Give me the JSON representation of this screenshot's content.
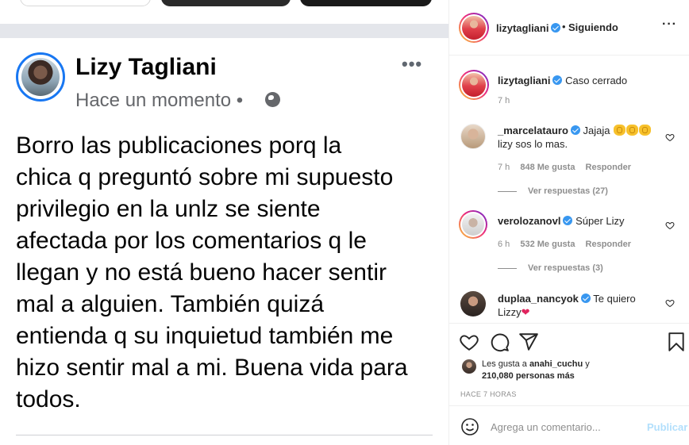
{
  "post_image": {
    "author": "Lizy Tagliani",
    "time": "Hace un momento •",
    "more": "•••",
    "text_lines": [
      "Borro las publicaciones porq la",
      "chica q preguntó sobre mi supuesto",
      "privilegio en la  unlz se siente",
      "afectada por los comentarios q le",
      "llegan y no está bueno hacer sentir",
      "mal a alguien. También quizá",
      "entienda q su inquietud también me",
      "hizo sentir mal a mi. Buena vida para",
      "todos."
    ]
  },
  "header": {
    "username": "lizytagliani",
    "separator": "•",
    "follow_status": "Siguiendo",
    "more": "···"
  },
  "caption": {
    "username": "lizytagliani",
    "text": "Caso cerrado",
    "time": "7 h"
  },
  "comments": [
    {
      "username": "_marcelatauro",
      "text": "Jajaja",
      "text2": "lizy sos lo mas.",
      "time": "7 h",
      "likes": "848 Me gusta",
      "reply": "Responder",
      "view_replies": "Ver respuestas (27)"
    },
    {
      "username": "verolozanovl",
      "text": "Súper Lizy",
      "time": "6 h",
      "likes": "532 Me gusta",
      "reply": "Responder",
      "view_replies": "Ver respuestas (3)"
    },
    {
      "username": "duplaa_nancyok",
      "text": "Te quiero",
      "text2": "Lizzy"
    }
  ],
  "likes": {
    "prefix": "Les gusta a",
    "user": "anahi_cuchu",
    "middle": "y",
    "count": "210,080 personas más"
  },
  "timestamp": "HACE 7 HORAS",
  "add_comment": {
    "placeholder": "Agrega un comentario...",
    "publish": "Publicar"
  },
  "colors": {
    "verified": "#3897f0",
    "publish_disabled": "#b2dffc",
    "fb_ring": "#1877f2"
  },
  "icons": [
    "globe-icon",
    "verified-icon",
    "heart-icon",
    "comment-icon",
    "share-icon",
    "bookmark-icon",
    "emoji-icon",
    "clap-emoji",
    "red-heart-emoji"
  ]
}
